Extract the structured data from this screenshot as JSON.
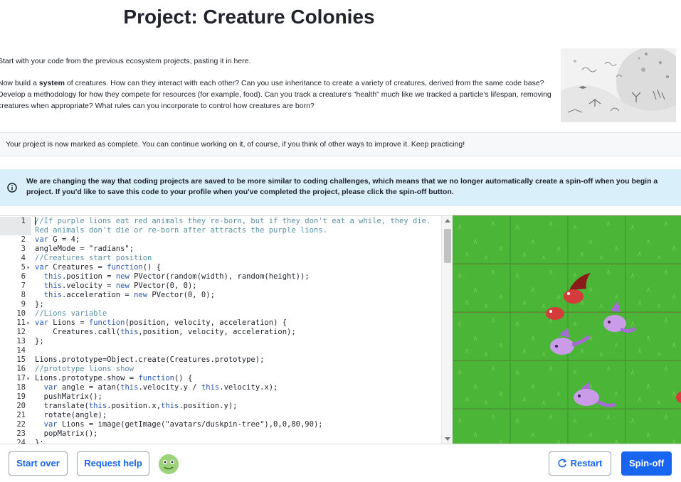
{
  "page": {
    "title": "Project: Creature Colonies",
    "intro_p1": "Start with your code from the previous ecosystem projects, pasting it in here.",
    "intro_p2_a": "Now build a ",
    "intro_p2_b": "system",
    "intro_p2_c": " of creatures. How can they interact with each other? Can you use inheritance to create a variety of creatures, derived from the same code base? Develop a methodology for how they compete for resources (for example, food). Can you track a creature's \"health\" much like we tracked a particle's lifespan, removing creatures when appropriate? What rules can you incorporate to control how creatures are born?",
    "complete_msg": "Your project is now marked as complete. You can continue working on it, of course, if you think of other ways to improve it. Keep practicing!",
    "info_msg": "We are changing the way that coding projects are saved to be more similar to coding challenges, which means that we no longer automatically create a spin-off when you begin a project. If you'd like to save this code to your profile when you've completed the project, please click the spin-off button."
  },
  "editor": {
    "lines": [
      {
        "n": "1",
        "fold": "",
        "parts": [
          [
            "c-com",
            "//If purple lions eat red animals they re-born, but if they don't eat a while, they die."
          ]
        ]
      },
      {
        "n": "",
        "fold": "",
        "parts": [
          [
            "c-com",
            "Red animals don't die or re-born after attracts the purple lions."
          ]
        ]
      },
      {
        "n": "2",
        "fold": "",
        "parts": [
          [
            "c-key",
            "var"
          ],
          [
            "",
            " G = 4;"
          ]
        ]
      },
      {
        "n": "3",
        "fold": "",
        "parts": [
          [
            "",
            "angleMode = \"radians\";"
          ]
        ]
      },
      {
        "n": "4",
        "fold": "",
        "parts": [
          [
            "c-com",
            "//Creatures start position"
          ]
        ]
      },
      {
        "n": "5",
        "fold": "▾",
        "parts": [
          [
            "c-key",
            "var"
          ],
          [
            "",
            " Creatures = "
          ],
          [
            "c-key",
            "function"
          ],
          [
            "",
            "() {"
          ]
        ]
      },
      {
        "n": "6",
        "fold": "",
        "parts": [
          [
            "",
            "  "
          ],
          [
            "c-key",
            "this"
          ],
          [
            "",
            ".position = "
          ],
          [
            "c-key",
            "new"
          ],
          [
            "",
            " PVector(random(width), random(height));"
          ]
        ]
      },
      {
        "n": "7",
        "fold": "",
        "parts": [
          [
            "",
            "  "
          ],
          [
            "c-key",
            "this"
          ],
          [
            "",
            ".velocity = "
          ],
          [
            "c-key",
            "new"
          ],
          [
            "",
            " PVector(0, 0);"
          ]
        ]
      },
      {
        "n": "8",
        "fold": "",
        "parts": [
          [
            "",
            "  "
          ],
          [
            "c-key",
            "this"
          ],
          [
            "",
            ".acceleration = "
          ],
          [
            "c-key",
            "new"
          ],
          [
            "",
            " PVector(0, 0);"
          ]
        ]
      },
      {
        "n": "9",
        "fold": "",
        "parts": [
          [
            "",
            "};"
          ]
        ]
      },
      {
        "n": "10",
        "fold": "",
        "parts": [
          [
            "c-com",
            "//Lions variable"
          ]
        ]
      },
      {
        "n": "11",
        "fold": "▾",
        "parts": [
          [
            "c-key",
            "var"
          ],
          [
            "",
            " Lions = "
          ],
          [
            "c-key",
            "function"
          ],
          [
            "",
            "(position, velocity, acceleration) {"
          ]
        ]
      },
      {
        "n": "12",
        "fold": "",
        "parts": [
          [
            "",
            "    Creatures.call("
          ],
          [
            "c-key",
            "this"
          ],
          [
            "",
            ",position, velocity, acceleration);"
          ]
        ]
      },
      {
        "n": "13",
        "fold": "",
        "parts": [
          [
            "",
            "};"
          ]
        ]
      },
      {
        "n": "14",
        "fold": "",
        "parts": [
          [
            "",
            ""
          ]
        ]
      },
      {
        "n": "15",
        "fold": "",
        "parts": [
          [
            "",
            "Lions.prototype=Object.create(Creatures.prototype);"
          ]
        ]
      },
      {
        "n": "16",
        "fold": "",
        "parts": [
          [
            "c-com",
            "//prototype lions show"
          ]
        ]
      },
      {
        "n": "17",
        "fold": "▾",
        "parts": [
          [
            "",
            "Lions.prototype.show = "
          ],
          [
            "c-key",
            "function"
          ],
          [
            "",
            "() {"
          ]
        ]
      },
      {
        "n": "18",
        "fold": "",
        "parts": [
          [
            "",
            "  "
          ],
          [
            "c-key",
            "var"
          ],
          [
            "",
            " angle = atan("
          ],
          [
            "c-key",
            "this"
          ],
          [
            "",
            ".velocity.y / "
          ],
          [
            "c-key",
            "this"
          ],
          [
            "",
            ".velocity.x);"
          ]
        ]
      },
      {
        "n": "19",
        "fold": "",
        "parts": [
          [
            "",
            "  pushMatrix();"
          ]
        ]
      },
      {
        "n": "20",
        "fold": "",
        "parts": [
          [
            "",
            "  translate("
          ],
          [
            "c-key",
            "this"
          ],
          [
            "",
            ".position.x,"
          ],
          [
            "c-key",
            "this"
          ],
          [
            "",
            ".position.y);"
          ]
        ]
      },
      {
        "n": "21",
        "fold": "",
        "parts": [
          [
            "",
            "  rotate(angle);"
          ]
        ]
      },
      {
        "n": "22",
        "fold": "",
        "parts": [
          [
            "",
            "  "
          ],
          [
            "c-key",
            "var"
          ],
          [
            "",
            " Lions = image(getImage(\"avatars/duskpin-tree\"),0,0,80,90);"
          ]
        ]
      },
      {
        "n": "23",
        "fold": "",
        "parts": [
          [
            "",
            "  popMatrix();"
          ]
        ]
      },
      {
        "n": "24",
        "fold": "",
        "parts": [
          [
            "",
            "};"
          ]
        ]
      }
    ]
  },
  "footer": {
    "start_over": "Start over",
    "request_help": "Request help",
    "restart": "Restart",
    "spin_off": "Spin-off"
  },
  "colors": {
    "primary": "#1865f2",
    "info_bg": "#d9f0fb",
    "grass": "#4ab536"
  }
}
